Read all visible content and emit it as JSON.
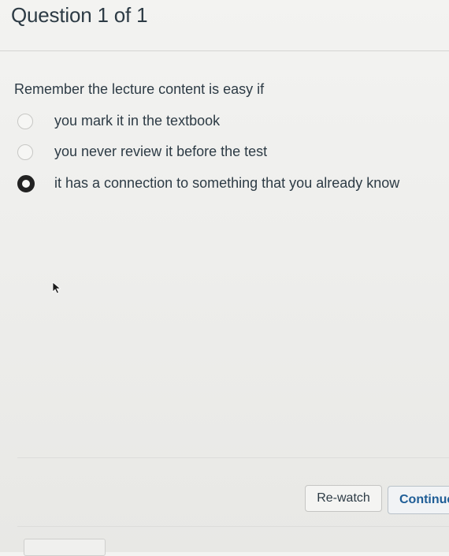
{
  "header": {
    "title": "Question 1 of 1"
  },
  "question": {
    "prompt": "Remember the lecture content is easy if",
    "options": [
      {
        "label": "you mark it in the textbook",
        "selected": false
      },
      {
        "label": "you never review it before the test",
        "selected": false
      },
      {
        "label": "it has a connection to something that you already know",
        "selected": true
      }
    ]
  },
  "footer": {
    "rewatch_label": "Re-watch",
    "continue_label": "Continue"
  }
}
